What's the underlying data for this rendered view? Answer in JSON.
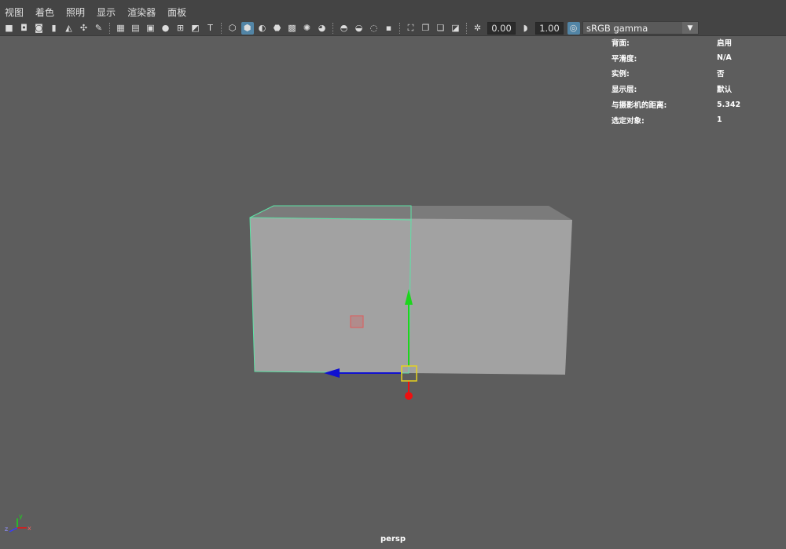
{
  "menubar": {
    "items": [
      "视图",
      "着色",
      "照明",
      "显示",
      "渲染器",
      "面板"
    ]
  },
  "toolbar": {
    "icons": [
      "camera-icon",
      "lock-camera-icon",
      "camera-attributes-icon",
      "bookmark-icon",
      "image-plane-icon",
      "pan-zoom-icon",
      "grease-pencil-icon",
      "sep",
      "grid-icon",
      "film-gate-icon",
      "resolution-gate-icon",
      "gate-mask-icon",
      "field-chart-icon",
      "safe-action-icon",
      "safe-title-icon",
      "sep",
      "wireframe-icon",
      "smooth-shade-icon",
      "wireframe-on-shaded-icon",
      "default-material-icon",
      "textured-icon",
      "lights-icon",
      "shadows-icon",
      "sep",
      "ambient-occlusion-icon",
      "motion-blur-icon",
      "anti-alias-icon",
      "depth-of-field-icon",
      "sep",
      "isolate-select-icon",
      "xray-icon",
      "xray-joints-icon",
      "xray-components-icon",
      "sep",
      "exposure-icon"
    ],
    "exposure_value": "0.00",
    "gamma_icon": "gamma-icon",
    "gamma_value": "1.00",
    "color_mgmt_icon": "color-management-icon",
    "color_space": "sRGB gamma"
  },
  "hud": [
    {
      "label": "背面:",
      "value": "启用"
    },
    {
      "label": "平滑度:",
      "value": "N/A"
    },
    {
      "label": "实例:",
      "value": "否"
    },
    {
      "label": "显示层:",
      "value": "默认"
    },
    {
      "label": "与摄影机的距离:",
      "value": "5.342"
    },
    {
      "label": "选定对象:",
      "value": "1"
    }
  ],
  "viewport": {
    "camera_label": "persp",
    "axis_y_label": "y",
    "axis_z_label": "z",
    "axis_x_label": "x"
  },
  "colors": {
    "background": "#5d5d5d",
    "toolbar": "#444444",
    "selection_highlight": "#5de3a5",
    "manip_y": "#1dd51d",
    "manip_z": "#1010d0",
    "manip_x": "#ee1010",
    "manip_center": "#e6d21e"
  }
}
